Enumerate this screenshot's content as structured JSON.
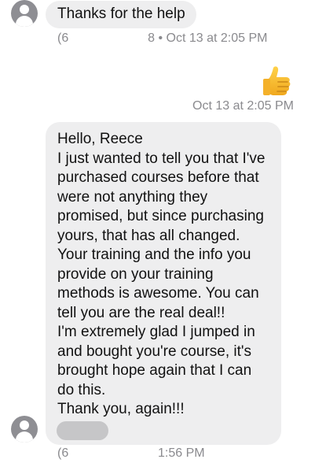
{
  "messages": {
    "top": {
      "text": "Thanks for the help",
      "meta_prefix": "(6",
      "meta_suffix": "8 • Oct 13 at 2:05 PM"
    },
    "reaction": {
      "icon": "thumbs-up-icon",
      "time": "Oct 13 at 2:05 PM"
    },
    "main": {
      "lines": [
        "Hello, Reece",
        "I just wanted to tell you that I've",
        "purchased courses before that",
        "were not anything they",
        "promised, but since purchasing",
        "yours, that has all changed.",
        "Your training and the info you",
        "provide on your training",
        "methods is awesome. You can",
        "tell you are the real deal!!",
        "I'm extremely glad I jumped in",
        "and bought you're course, it's",
        "brought hope again that I can",
        "do this.",
        "Thank you, again!!!"
      ],
      "meta_left": "(6",
      "meta_time": "1:56 PM"
    }
  },
  "colors": {
    "bubble": "#eeeeef",
    "meta_text": "#8a8a8e",
    "avatar": "#8e8e93",
    "redaction": "#c6c6c8",
    "thumb": "#f5b629"
  }
}
